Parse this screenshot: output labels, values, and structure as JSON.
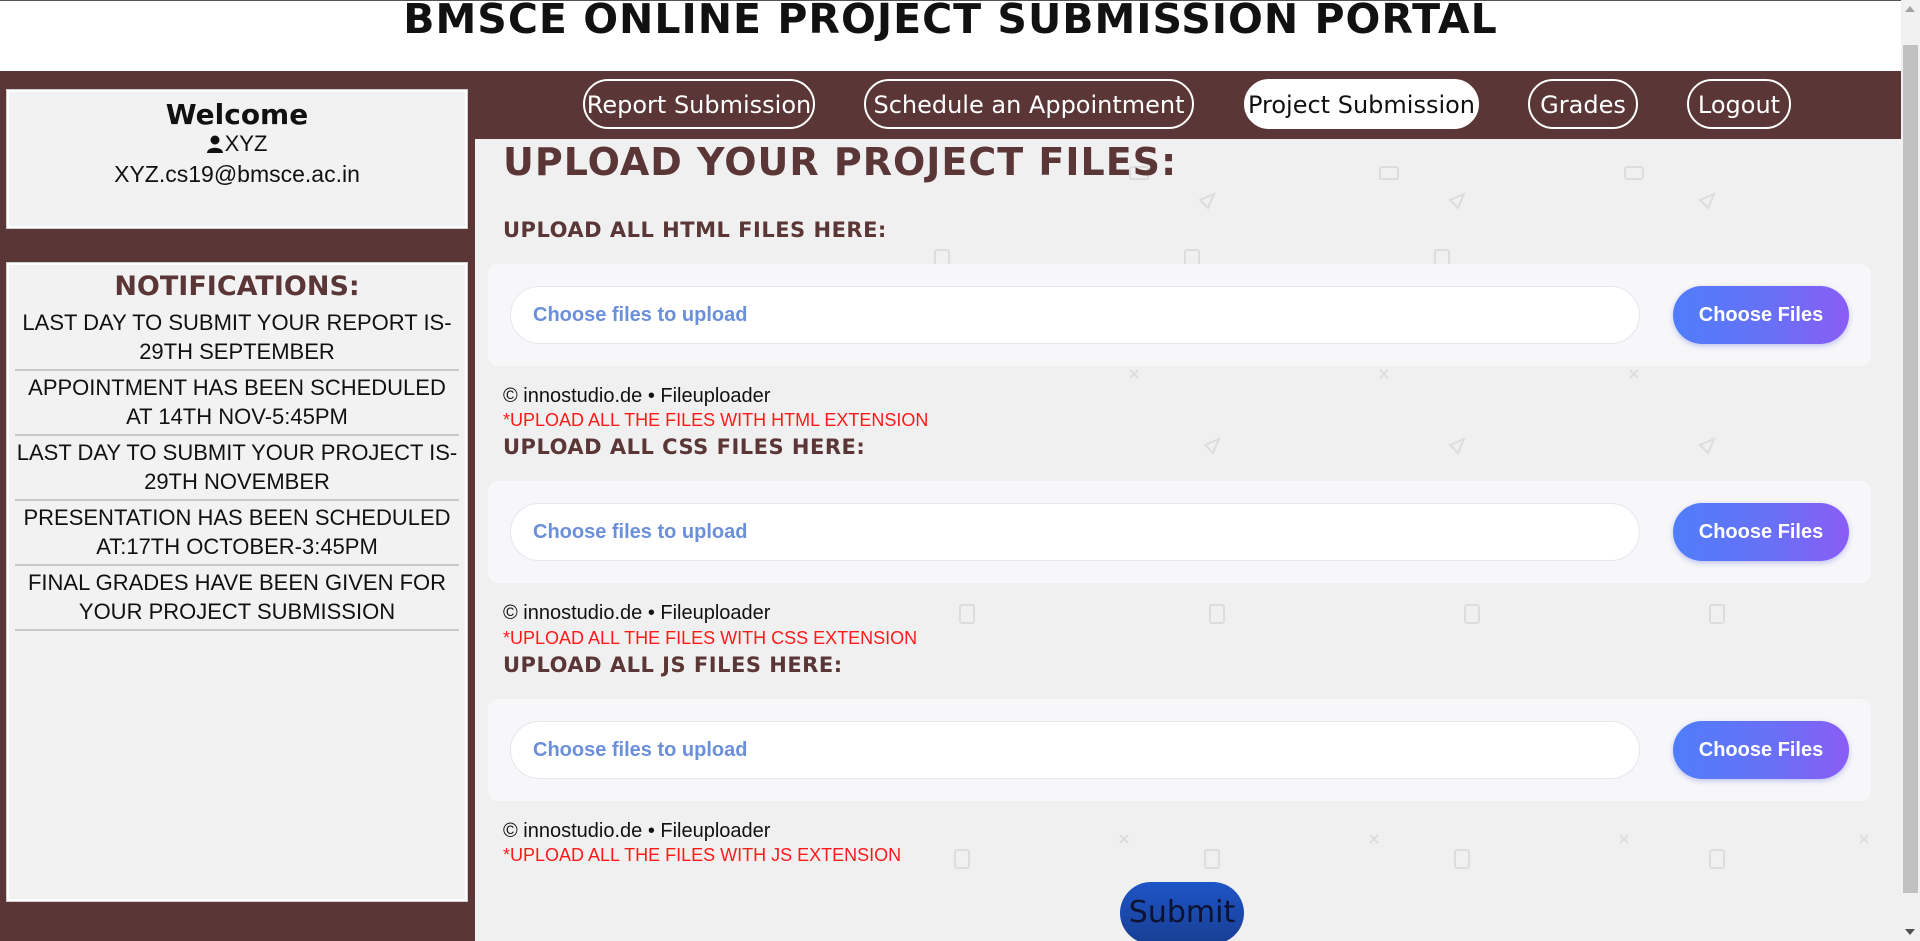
{
  "header": {
    "title": "BMSCE ONLINE PROJECT SUBMISSION PORTAL"
  },
  "sidebar": {
    "welcome": {
      "title": "Welcome",
      "username": "XYZ",
      "email": "XYZ.cs19@bmsce.ac.in"
    },
    "notifications": {
      "title": "NOTIFICATIONS:",
      "items": [
        "LAST DAY TO SUBMIT YOUR REPORT IS-29TH SEPTEMBER",
        "APPOINTMENT HAS BEEN SCHEDULED AT 14TH NOV-5:45PM",
        "LAST DAY TO SUBMIT YOUR PROJECT IS-29TH NOVEMBER",
        "PRESENTATION HAS BEEN SCHEDULED AT:17TH OCTOBER-3:45PM",
        "FINAL GRADES HAVE BEEN GIVEN FOR YOUR PROJECT SUBMISSION"
      ]
    }
  },
  "nav": {
    "items": [
      {
        "label": "Report Submission",
        "active": false
      },
      {
        "label": "Schedule an Appointment",
        "active": false
      },
      {
        "label": "Project Submission",
        "active": true
      },
      {
        "label": "Grades",
        "active": false
      },
      {
        "label": "Logout",
        "active": false
      }
    ]
  },
  "main": {
    "heading": "UPLOAD YOUR PROJECT FILES:",
    "uploaders": [
      {
        "label": "UPLOAD ALL HTML FILES HERE:",
        "placeholder": "Choose files to upload",
        "button": "Choose Files",
        "credit": "© innostudio.de • Fileuploader",
        "warning": "*UPLOAD ALL THE FILES WITH HTML EXTENSION"
      },
      {
        "label": "UPLOAD ALL CSS FILES HERE:",
        "placeholder": "Choose files to upload",
        "button": "Choose Files",
        "credit": "© innostudio.de • Fileuploader",
        "warning": "*UPLOAD ALL THE FILES WITH CSS EXTENSION"
      },
      {
        "label": "UPLOAD ALL JS FILES HERE:",
        "placeholder": "Choose files to upload",
        "button": "Choose Files",
        "credit": "© innostudio.de • Fileuploader",
        "warning": "*UPLOAD ALL THE FILES WITH JS EXTENSION"
      }
    ],
    "submit_label": "Submit"
  },
  "colors": {
    "brand_brown": "#5b3636",
    "warning_red": "#ff1a1a",
    "uploader_gradient_start": "#4f7dfb",
    "uploader_gradient_end": "#8a5cf6",
    "submit_blue": "#1f55c7"
  }
}
